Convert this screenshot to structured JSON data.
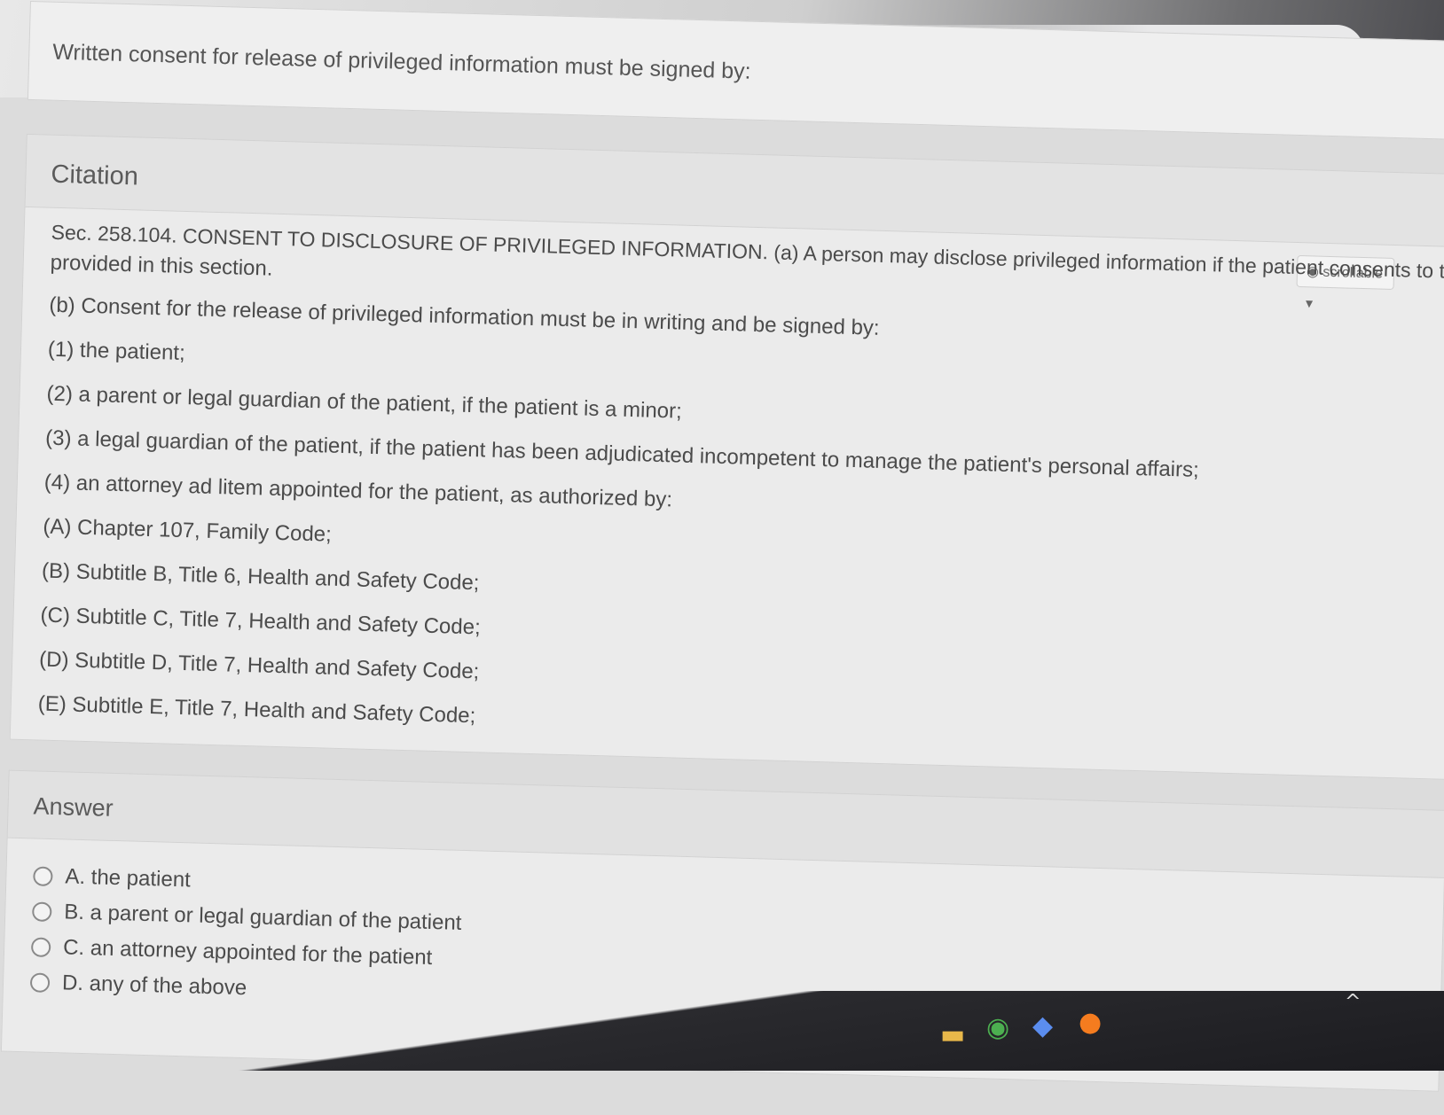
{
  "browser": {
    "star_icon": "☆",
    "extension_icon": "⬚"
  },
  "question": {
    "text": "Written consent for release of privileged information must be signed by:"
  },
  "citation": {
    "title": "Citation",
    "scrollable_label": "scrollable",
    "lines": [
      "Sec. 258.104. CONSENT TO DISCLOSURE OF PRIVILEGED INFORMATION. (a) A person may disclose privileged information if the patient consents to the disclosure as",
      "provided in this section.",
      "(b) Consent for the release of privileged information must be in writing and be signed by:",
      "(1) the patient;",
      "(2) a parent or legal guardian of the patient, if the patient is a minor;",
      "(3) a legal guardian of the patient, if the patient has been adjudicated incompetent to manage the patient's personal affairs;",
      "(4) an attorney ad litem appointed for the patient, as authorized by:",
      "(A) Chapter 107, Family Code;",
      "(B) Subtitle B, Title 6, Health and Safety Code;",
      "(C) Subtitle C, Title 7, Health and Safety Code;",
      "(D) Subtitle D, Title 7, Health and Safety Code;",
      "(E) Subtitle E, Title 7, Health and Safety Code;"
    ]
  },
  "answer": {
    "title": "Answer",
    "options": [
      "A. the patient",
      "B. a parent or legal guardian of the patient",
      "C. an attorney appointed for the patient",
      "D. any of the above"
    ]
  },
  "colors": {
    "taskbar": "#1c1c20",
    "card": "#ececec"
  }
}
